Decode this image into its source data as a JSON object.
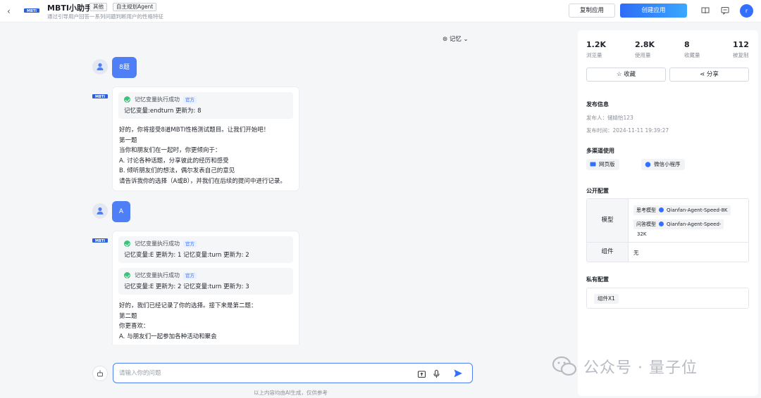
{
  "header": {
    "app_title": "MBTI小助手",
    "tags": [
      "其他",
      "自主规划Agent"
    ],
    "description": "通过引导用户回答一系列问题判断用户的性格特征",
    "copy_button": "复制应用",
    "create_button": "创建应用",
    "user_initial": "r",
    "logo_text": "MBTI"
  },
  "chat": {
    "memory_label": "记忆",
    "messages": [
      {
        "role": "user",
        "text": "8题"
      },
      {
        "role": "bot",
        "tools": [
          {
            "title": "记忆变量执行成功",
            "badge": "官方",
            "text": "记忆变量:endturn 更新为: 8"
          }
        ],
        "reply_lines": [
          "好的，你将接受8道MBTI性格测试题目。让我们开始吧！",
          "第一题",
          "当你和朋友们在一起时，你更倾向于：",
          "A. 讨论各种话题，分享彼此的经历和感受",
          "B. 倾听朋友们的想法，偶尔发表自己的意见",
          "请告诉我你的选择（A或B），并我们在后续的提问中进行记录。"
        ]
      },
      {
        "role": "user",
        "text": "A"
      },
      {
        "role": "bot",
        "tools": [
          {
            "title": "记忆变量执行成功",
            "badge": "官方",
            "text": "记忆变量:E 更新为: 1 记忆变量:turn 更新为: 2"
          },
          {
            "title": "记忆变量执行成功",
            "badge": "官方",
            "text": "记忆变量:E 更新为: 2 记忆变量:turn 更新为: 3"
          }
        ],
        "reply_lines": [
          "好的，我们已经记录了你的选择。接下来是第二题：",
          "第二题",
          "你更喜欢：",
          "A. 与朋友们一起参加各种活动和聚会"
        ]
      }
    ],
    "input_placeholder": "请输入你的问题",
    "footer_note": "以上内容均由AI生成，仅供参考"
  },
  "panel": {
    "stats": [
      {
        "value": "1.2K",
        "label": "浏览量"
      },
      {
        "value": "2.8K",
        "label": "使用量"
      },
      {
        "value": "8",
        "label": "收藏量"
      },
      {
        "value": "112",
        "label": "被复制"
      }
    ],
    "favorite_button": "收藏",
    "share_button": "分享",
    "publish_title": "发布信息",
    "publisher_label": "发布人：",
    "publisher": "储婧怡123",
    "publish_time_label": "发布时间：",
    "publish_time": "2024-11-11 19:39:27",
    "channels_title": "多渠道使用",
    "channels": [
      "网页版",
      "微信小程序"
    ],
    "public_config_title": "公开配置",
    "config": {
      "model_key": "模型",
      "think_model_label": "思考模型",
      "think_model": "Qianfan-Agent-Speed-8K",
      "answer_model_label": "问答模型",
      "answer_model": "Qianfan-Agent-Speed-",
      "answer_model_suffix": "32K",
      "component_key": "组件",
      "component_value": "无"
    },
    "private_config_title": "私有配置",
    "private_component": "组件X1"
  },
  "watermark": "公众号 · 量子位",
  "colors": {
    "accent": "#3370ff",
    "user_bubble": "#4e7ff6",
    "success": "#3cc27b"
  }
}
